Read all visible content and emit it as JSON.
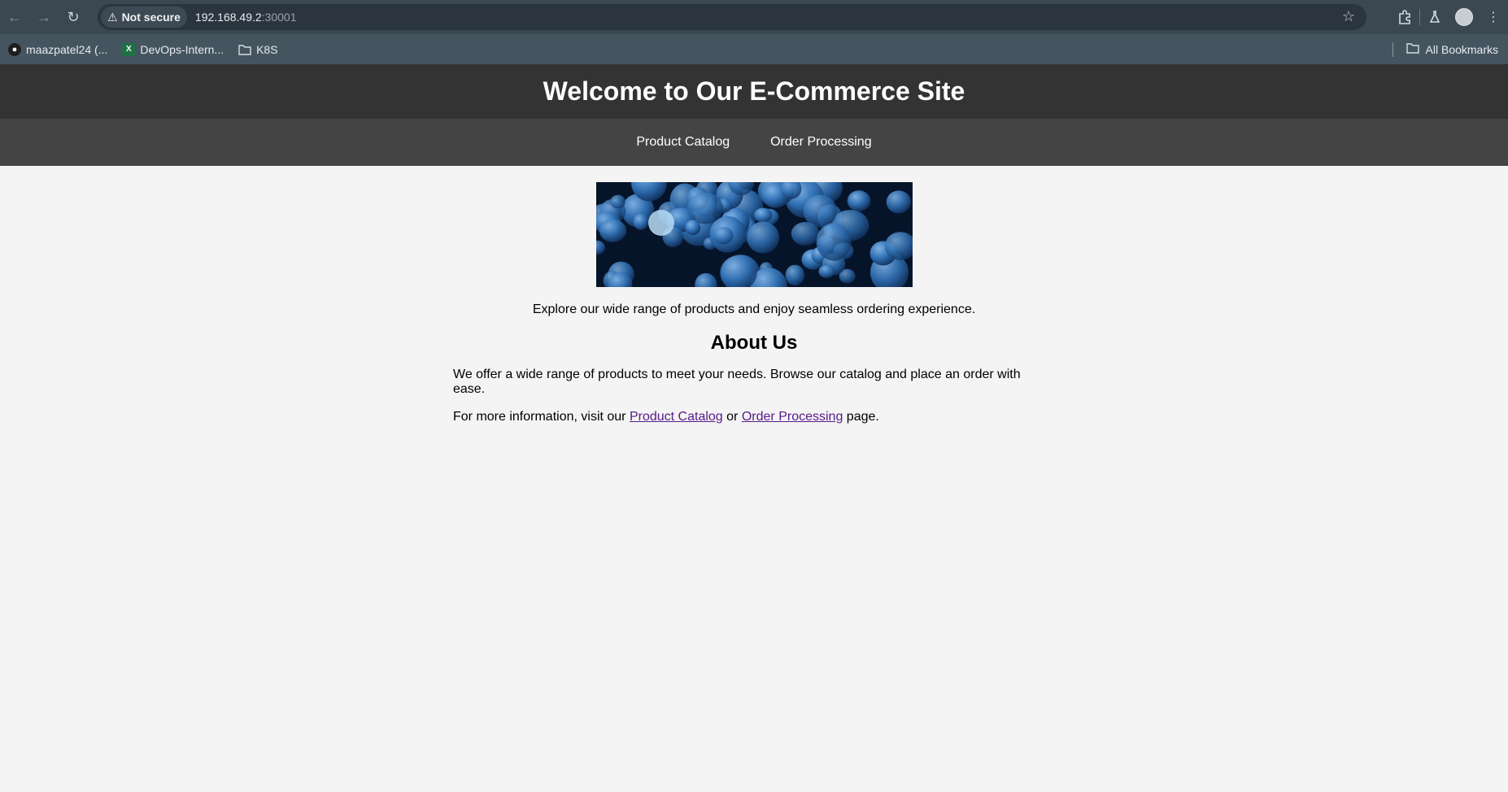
{
  "browser": {
    "security_label": "Not secure",
    "url_host": "192.168.49.2",
    "url_port": ":30001",
    "bookmarks": [
      {
        "label": "maazpatel24 (...",
        "icon": "github-icon"
      },
      {
        "label": "DevOps-Intern...",
        "icon": "excel-icon"
      },
      {
        "label": "K8S",
        "icon": "folder-icon"
      }
    ],
    "all_bookmarks_label": "All Bookmarks"
  },
  "site": {
    "title": "Welcome to Our E-Commerce Site",
    "nav": {
      "product_catalog": "Product Catalog",
      "order_processing": "Order Processing"
    },
    "tagline": "Explore our wide range of products and enjoy seamless ordering experience.",
    "about_heading": "About Us",
    "about_text": "We offer a wide range of products to meet your needs. Browse our catalog and place an order with ease.",
    "more_info_prefix": "For more information, visit our",
    "more_info_link1": "Product Catalog",
    "more_info_or": "or",
    "more_info_link2": "Order Processing",
    "more_info_suffix": "page."
  },
  "colors": {
    "header_bg": "#333333",
    "nav_bg": "#444444",
    "page_bg": "#f4f4f4",
    "link_visited": "#551a8b"
  }
}
